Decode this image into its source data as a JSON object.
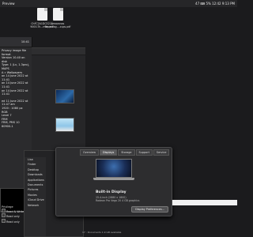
{
  "menubar": {
    "app": "Preview",
    "status": "47 ⌨ 5% 12:42 9:13 PM"
  },
  "desktop": {
    "files": [
      {
        "name": "ChFC2A1DC5211 9000-Th...mon.pdf"
      },
      {
        "name": "Amazonas Paperbag....cups.pdf"
      }
    ]
  },
  "info_window": {
    "time": "10:41",
    "lines": [
      "Privacy image file format",
      "Version 10.40 on disk",
      "Type: 1 (Lv, 1.3pro), MAPS",
      "A » Wallpapers",
      "on 14 June 2022 at 11:41",
      "on 14 June 2022 at 11:41",
      "on 14 June 2022 at 11:41"
    ],
    "lines2": [
      "ed 11 June 2022 at 11:47 am",
      "1920 : 1080 px",
      "RGB",
      "Level 7",
      "FRM",
      "FRM, PMS 10 60900-1"
    ],
    "permissions": [
      "Privilege",
      "Read & Write",
      "Read only",
      "Read only"
    ]
  },
  "finder_sidebar": [
    "Lisa",
    "Finder",
    "Desktop",
    "Downloads",
    "Applications",
    "Documents",
    "Pictures",
    "Movies",
    "iCloud Drive",
    "Network"
  ],
  "about": {
    "tabs": [
      "Overview",
      "Displays",
      "Storage",
      "Support",
      "Service"
    ],
    "title": "Built-in Display",
    "line1": "15.4-inch (2880 x 1800)",
    "line2": "Radeon Pro Vega 20 4 GB graphics",
    "button": "Display Preferences..."
  },
  "statusbar": "17 : Documents   1.9 GB available"
}
